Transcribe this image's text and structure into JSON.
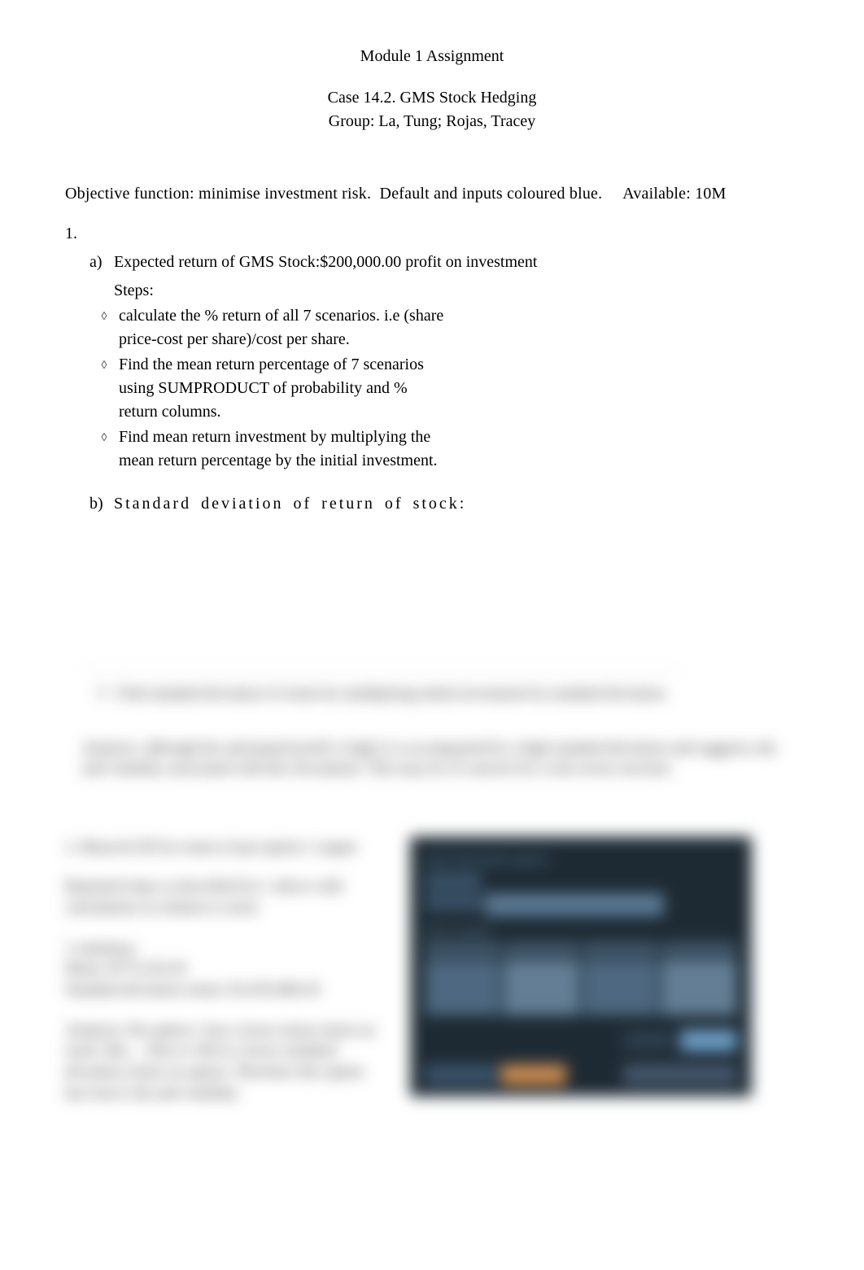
{
  "header": {
    "title": "Module 1 Assignment",
    "case": "Case 14.2. GMS Stock Hedging",
    "group": "Group: La, Tung; Rojas, Tracey"
  },
  "objective_line": "Objective function: minimise investment risk.  Default and inputs coloured blue.     Available: 10M",
  "q1": {
    "number": "1.",
    "a": {
      "label": "a)",
      "text": "Expected return of GMS Stock:$200,000.00 profit on investment",
      "steps_label": "Steps:",
      "bullets": [
        " calculate the % return of all 7 scenarios. i.e (share price-cost per share)/cost per share.",
        " Find the mean return percentage of 7 scenarios using SUMPRODUCT of probability and % return columns.",
        " Find mean return investment by multiplying the mean return percentage by the initial investment."
      ]
    },
    "b": {
      "label": "b)",
      "text": "Standard deviation of return of stock:"
    }
  },
  "blurred": {
    "sd_bullet": "Find standard deviation of return by multiplying initial investment by standard deviation.",
    "analysis": "Analysis: although the anticipated profit is high it is accompanied by a high standard deviation and suggests risk and volatility associated with this investment. This may be of concern for a risk averse investor.",
    "q2": {
      "title": "2.  Mean & SD for return of put option 1 output",
      "p1": "Repeated steps as described for 1 above with calculations in relation to stock",
      "summary_label": "1 summary:",
      "mean": "Mean: $775,510.20",
      "sd": "Standard deviation return:  $1,935,000.20",
      "p2": "Analysis: Put option 1 has a lower mean return on stock. But ... Due to 1M in a lower standard deviation return on option. Therefore this option has lower risk and volatility."
    },
    "spreadsheet": {
      "title": "Input Information (given)",
      "row_labels": [
        "Share",
        "Cost/sh"
      ],
      "section_label": "Return analysis",
      "col_headers": [
        "Scenario",
        "Prob",
        "Price",
        "Return"
      ],
      "bottom_text": "Mean",
      "footer_left": "Parameters",
      "footer_highlight": "results"
    }
  },
  "bullet_glyph": "◊"
}
